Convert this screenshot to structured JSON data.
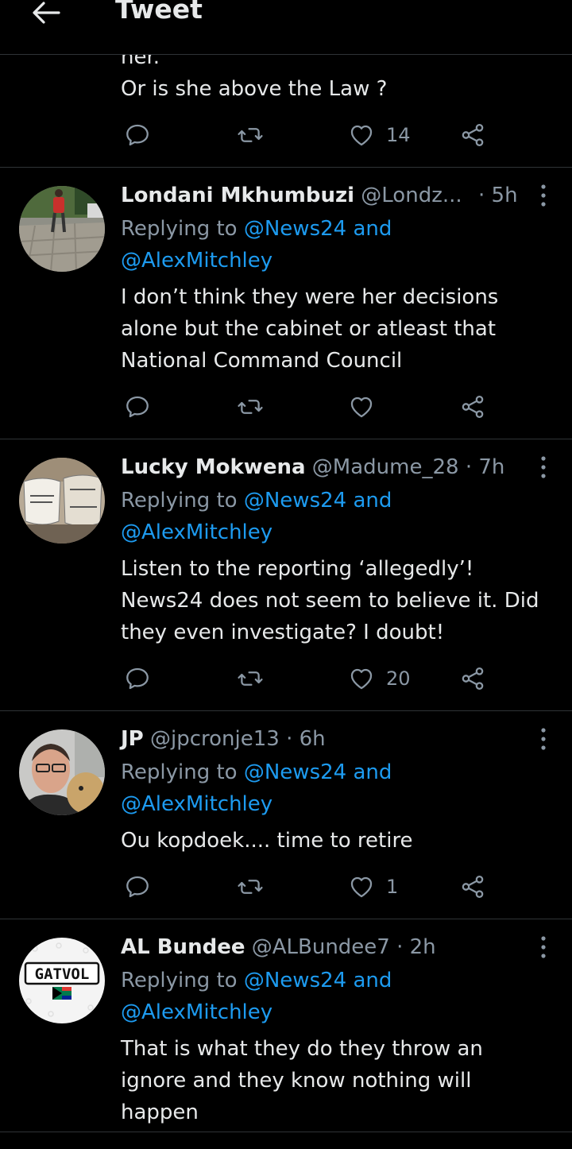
{
  "header": {
    "title": "Tweet"
  },
  "top_tweet": {
    "text_partial": "her.",
    "text_last": "Or is she above the Law  ?",
    "likes": "14"
  },
  "replies": [
    {
      "name": "Londani Mkhumbuzi",
      "handle": "@Londz...",
      "time": "· 5h",
      "replying_prefix": "Replying to",
      "replying_line1": "@News24 and",
      "replying_line2": "@AlexMitchley",
      "text_lines": [
        "I don’t think they were her decisions",
        "alone but  the cabinet or atleast that",
        "National Command Council"
      ],
      "likes": ""
    },
    {
      "name": "Lucky Mokwena",
      "handle": "@Madume_28",
      "time": "· 7h",
      "replying_prefix": "Replying to",
      "replying_line1": "@News24 and",
      "replying_line2": "@AlexMitchley",
      "text_lines": [
        "Listen to the reporting ‘allegedly’!",
        "News24 does not seem to believe it. Did",
        "they even investigate? I doubt!"
      ],
      "likes": "20"
    },
    {
      "name": "JP",
      "handle": "@jpcronje13",
      "time": "· 6h",
      "replying_prefix": "Replying to",
      "replying_line1": "@News24 and",
      "replying_line2": "@AlexMitchley",
      "text_lines": [
        "Ou kopdoek.... time to retire"
      ],
      "likes": "1"
    },
    {
      "name": "AL Bundee",
      "handle": "@ALBundee7",
      "time": "· 2h",
      "replying_prefix": "Replying to",
      "replying_line1": "@News24 and",
      "replying_line2": "@AlexMitchley",
      "text_lines": [
        "That is what they do they throw an",
        "ignore and they know nothing will",
        "happen"
      ],
      "likes": "",
      "avatar_text": "GATVOL"
    }
  ],
  "colors": {
    "background": "#000000",
    "text": "#e7e9ea",
    "muted": "#8b98a5",
    "link": "#1d9bf0",
    "divider": "#2f3336"
  },
  "icons": [
    "back-arrow-icon",
    "reply-icon",
    "retweet-icon",
    "like-icon",
    "share-icon",
    "more-icon"
  ]
}
